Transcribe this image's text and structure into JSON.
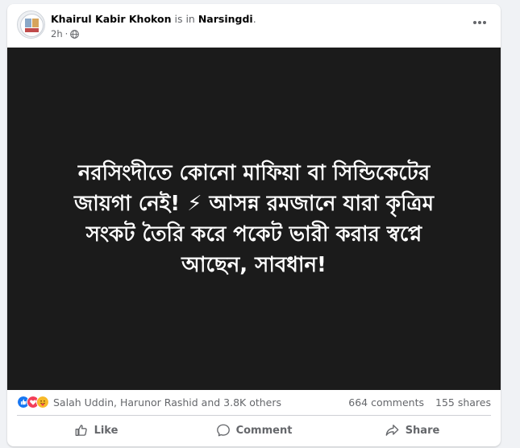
{
  "post": {
    "author": "Khairul Kabir Khokon",
    "is_in_text": "is in",
    "location": "Narsingdi",
    "location_suffix": ".",
    "time": "2h",
    "dot": "·",
    "audience_icon": "globe-icon",
    "more_icon": "more-options-icon",
    "body_text": "নরসিংদীতে কোনো মাফিয়া বা সিন্ডিকেটের\nজায়গা নেই! ⚡ আসন্ন রমজানে যারা কৃত্রিম\nসংকট তৈরি করে পকেট ভারী করার স্বপ্নে\nআছেন, সাবধান!"
  },
  "engagement": {
    "reactors": "Salah Uddin, Harunor Rashid and 3.8K others",
    "comments": "664 comments",
    "shares": "155 shares",
    "reaction_icons": [
      "like-icon",
      "love-icon",
      "care-icon"
    ]
  },
  "actions": {
    "like": "Like",
    "comment": "Comment",
    "share": "Share"
  },
  "colors": {
    "page_bg": "#f0f2f5",
    "card_bg": "#ffffff",
    "media_bg": "#1b1b1b",
    "meta_text": "#65676b",
    "like_blue": "#1877f2",
    "love_red": "#f33e58",
    "care_yellow": "#f7b928"
  }
}
